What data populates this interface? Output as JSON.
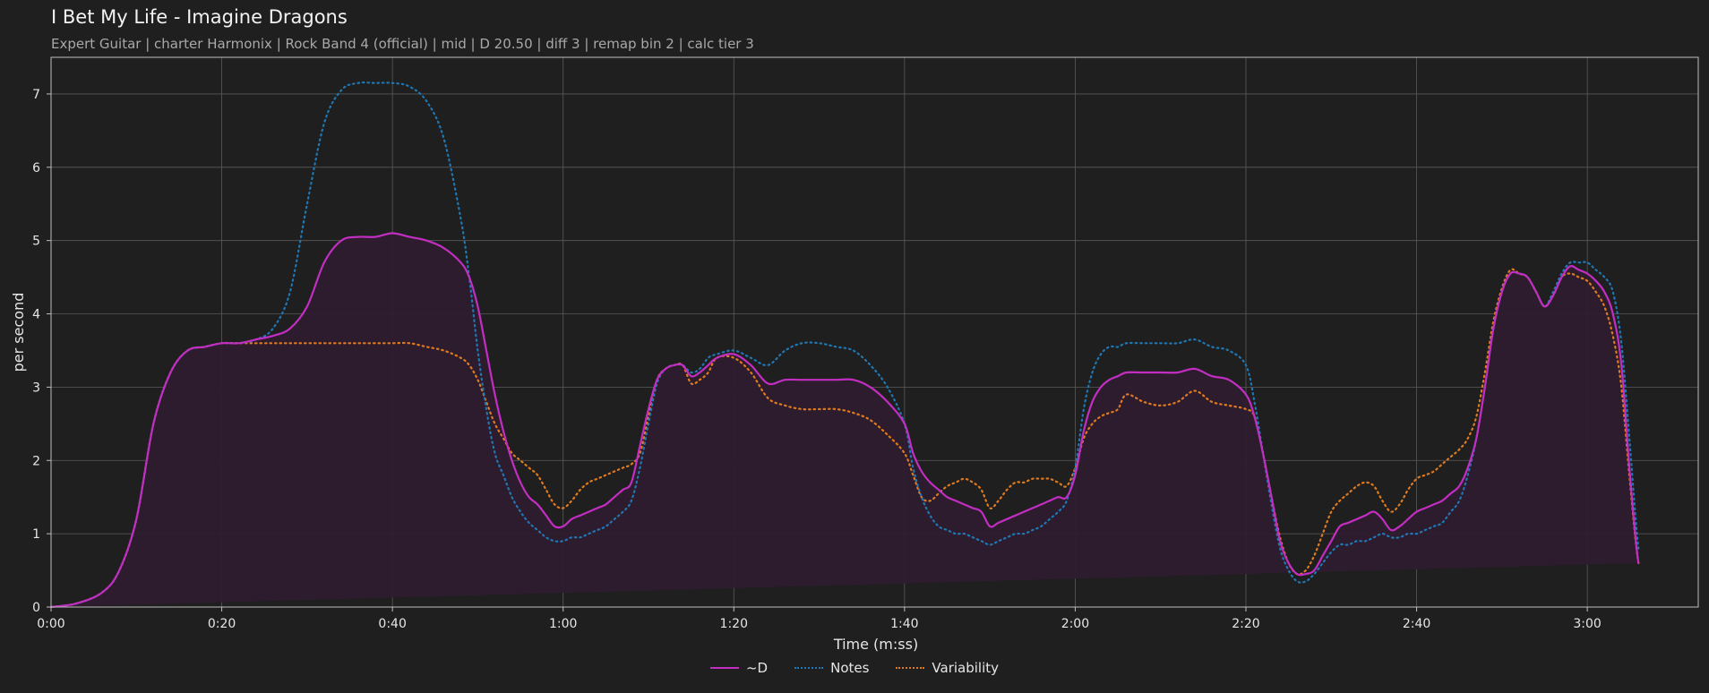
{
  "title": "I Bet My Life - Imagine Dragons",
  "subtitle": "Expert Guitar  |  charter Harmonix  |  Rock Band 4 (official)  |  mid  |  D 20.50  |  diff 3  |  remap bin 2  |  calc tier 3",
  "colors": {
    "background": "#1f1f1f",
    "grid": "#5a5a5a",
    "axis": "#bfbfbf",
    "d": "#c22ec2",
    "d_fill": "#2e1c2e",
    "notes": "#1f77b4",
    "variability": "#e07a1f"
  },
  "chart_data": {
    "type": "line",
    "xlabel": "Time (m:ss)",
    "ylabel": "per second",
    "xlim": [
      0,
      193
    ],
    "ylim": [
      0,
      7.5
    ],
    "x_tick_values": [
      0,
      20,
      40,
      60,
      80,
      100,
      120,
      140,
      160,
      180
    ],
    "x_tick_labels": [
      "0:00",
      "0:20",
      "0:40",
      "1:00",
      "1:20",
      "1:40",
      "2:00",
      "2:20",
      "2:40",
      "3:00"
    ],
    "y_ticks": [
      0,
      1,
      2,
      3,
      4,
      5,
      6,
      7
    ],
    "grid": true,
    "legend_position": "bottom-center",
    "x": [
      0,
      3,
      6,
      8,
      10,
      12,
      14,
      16,
      18,
      20,
      22,
      24,
      26,
      28,
      30,
      32,
      34,
      36,
      38,
      40,
      42,
      44,
      46,
      48,
      49,
      50,
      51,
      52,
      53,
      54,
      55,
      56,
      57,
      58,
      59,
      60,
      61,
      62,
      63,
      64,
      65,
      66,
      67,
      68,
      69,
      70,
      71,
      72,
      73,
      74,
      75,
      76,
      77,
      78,
      80,
      82,
      84,
      86,
      88,
      90,
      92,
      94,
      96,
      98,
      100,
      101,
      102,
      103,
      104,
      105,
      106,
      107,
      108,
      109,
      110,
      111,
      112,
      113,
      114,
      115,
      116,
      117,
      118,
      119,
      120,
      121,
      122,
      123,
      124,
      125,
      126,
      128,
      130,
      132,
      134,
      136,
      138,
      140,
      141,
      142,
      143,
      144,
      145,
      146,
      147,
      148,
      149,
      150,
      151,
      152,
      153,
      154,
      155,
      156,
      157,
      158,
      159,
      160,
      161,
      162,
      163,
      164,
      165,
      166,
      167,
      168,
      169,
      170,
      171,
      172,
      173,
      174,
      175,
      176,
      177,
      178,
      179,
      180,
      181,
      182,
      183,
      184,
      185,
      186,
      187,
      188,
      189,
      190,
      191,
      192,
      193
    ],
    "series": [
      {
        "name": "~D",
        "style": "solid",
        "fill": true,
        "values": [
          0,
          0.05,
          0.2,
          0.5,
          1.2,
          2.5,
          3.2,
          3.5,
          3.55,
          3.6,
          3.6,
          3.65,
          3.7,
          3.8,
          4.1,
          4.7,
          5.0,
          5.05,
          5.05,
          5.1,
          5.05,
          5.0,
          4.9,
          4.7,
          4.5,
          4.1,
          3.5,
          2.9,
          2.4,
          2.0,
          1.7,
          1.5,
          1.4,
          1.25,
          1.1,
          1.1,
          1.2,
          1.25,
          1.3,
          1.35,
          1.4,
          1.5,
          1.6,
          1.7,
          2.2,
          2.7,
          3.1,
          3.25,
          3.3,
          3.3,
          3.15,
          3.2,
          3.3,
          3.4,
          3.45,
          3.3,
          3.05,
          3.1,
          3.1,
          3.1,
          3.1,
          3.1,
          3.0,
          2.8,
          2.5,
          2.1,
          1.85,
          1.7,
          1.6,
          1.5,
          1.45,
          1.4,
          1.35,
          1.3,
          1.1,
          1.15,
          1.2,
          1.25,
          1.3,
          1.35,
          1.4,
          1.45,
          1.5,
          1.5,
          1.8,
          2.4,
          2.8,
          3.0,
          3.1,
          3.15,
          3.2,
          3.2,
          3.2,
          3.2,
          3.25,
          3.15,
          3.1,
          2.9,
          2.6,
          2.1,
          1.5,
          0.9,
          0.6,
          0.45,
          0.45,
          0.5,
          0.7,
          0.9,
          1.1,
          1.15,
          1.2,
          1.25,
          1.3,
          1.2,
          1.05,
          1.1,
          1.2,
          1.3,
          1.35,
          1.4,
          1.45,
          1.55,
          1.65,
          1.9,
          2.3,
          3.0,
          3.8,
          4.3,
          4.55,
          4.55,
          4.5,
          4.3,
          4.1,
          4.25,
          4.5,
          4.65,
          4.6,
          4.55,
          4.45,
          4.3,
          4.0,
          3.3,
          1.8,
          0.6,
          0.3
        ]
      },
      {
        "name": "Notes",
        "style": "dotted",
        "fill": false,
        "values": [
          0,
          0.05,
          0.2,
          0.5,
          1.2,
          2.5,
          3.2,
          3.5,
          3.55,
          3.6,
          3.6,
          3.65,
          3.8,
          4.3,
          5.5,
          6.6,
          7.05,
          7.15,
          7.15,
          7.15,
          7.1,
          6.9,
          6.4,
          5.3,
          4.5,
          3.5,
          2.7,
          2.1,
          1.8,
          1.5,
          1.3,
          1.15,
          1.05,
          0.95,
          0.9,
          0.9,
          0.95,
          0.95,
          1.0,
          1.05,
          1.1,
          1.2,
          1.3,
          1.45,
          1.9,
          2.5,
          3.05,
          3.25,
          3.3,
          3.3,
          3.2,
          3.25,
          3.4,
          3.45,
          3.5,
          3.4,
          3.3,
          3.5,
          3.6,
          3.6,
          3.55,
          3.5,
          3.3,
          3.0,
          2.5,
          1.9,
          1.5,
          1.25,
          1.1,
          1.05,
          1.0,
          1.0,
          0.95,
          0.9,
          0.85,
          0.9,
          0.95,
          1.0,
          1.0,
          1.05,
          1.1,
          1.2,
          1.3,
          1.45,
          1.9,
          2.7,
          3.2,
          3.45,
          3.55,
          3.55,
          3.6,
          3.6,
          3.6,
          3.6,
          3.65,
          3.55,
          3.5,
          3.3,
          2.8,
          2.1,
          1.4,
          0.8,
          0.5,
          0.35,
          0.35,
          0.45,
          0.6,
          0.75,
          0.85,
          0.85,
          0.9,
          0.9,
          0.95,
          1.0,
          0.95,
          0.95,
          1.0,
          1.0,
          1.05,
          1.1,
          1.15,
          1.3,
          1.45,
          1.8,
          2.3,
          3.0,
          3.8,
          4.3,
          4.55,
          4.55,
          4.5,
          4.3,
          4.1,
          4.3,
          4.55,
          4.7,
          4.7,
          4.7,
          4.6,
          4.5,
          4.3,
          3.6,
          2.2,
          0.8,
          0.3
        ]
      },
      {
        "name": "Variability",
        "style": "dotted",
        "fill": false,
        "values": [
          0,
          0.05,
          0.2,
          0.5,
          1.2,
          2.5,
          3.2,
          3.5,
          3.55,
          3.6,
          3.6,
          3.6,
          3.6,
          3.6,
          3.6,
          3.6,
          3.6,
          3.6,
          3.6,
          3.6,
          3.6,
          3.55,
          3.5,
          3.4,
          3.3,
          3.1,
          2.8,
          2.5,
          2.3,
          2.1,
          2.0,
          1.9,
          1.8,
          1.6,
          1.4,
          1.35,
          1.45,
          1.6,
          1.7,
          1.75,
          1.8,
          1.85,
          1.9,
          1.95,
          2.1,
          2.6,
          3.1,
          3.25,
          3.3,
          3.3,
          3.05,
          3.1,
          3.2,
          3.4,
          3.4,
          3.2,
          2.85,
          2.75,
          2.7,
          2.7,
          2.7,
          2.65,
          2.55,
          2.35,
          2.1,
          1.8,
          1.5,
          1.45,
          1.55,
          1.65,
          1.7,
          1.75,
          1.7,
          1.6,
          1.35,
          1.45,
          1.6,
          1.7,
          1.7,
          1.75,
          1.75,
          1.75,
          1.7,
          1.65,
          1.9,
          2.3,
          2.5,
          2.6,
          2.65,
          2.7,
          2.9,
          2.8,
          2.75,
          2.8,
          2.95,
          2.8,
          2.75,
          2.7,
          2.6,
          2.1,
          1.5,
          0.95,
          0.6,
          0.45,
          0.5,
          0.7,
          1.0,
          1.3,
          1.45,
          1.55,
          1.65,
          1.7,
          1.65,
          1.45,
          1.3,
          1.4,
          1.6,
          1.75,
          1.8,
          1.85,
          1.95,
          2.05,
          2.15,
          2.3,
          2.6,
          3.2,
          3.9,
          4.35,
          4.6,
          4.55,
          4.5,
          4.3,
          4.1,
          4.25,
          4.5,
          4.55,
          4.5,
          4.45,
          4.3,
          4.1,
          3.7,
          3.0,
          1.7,
          0.6,
          0.3
        ]
      }
    ]
  }
}
